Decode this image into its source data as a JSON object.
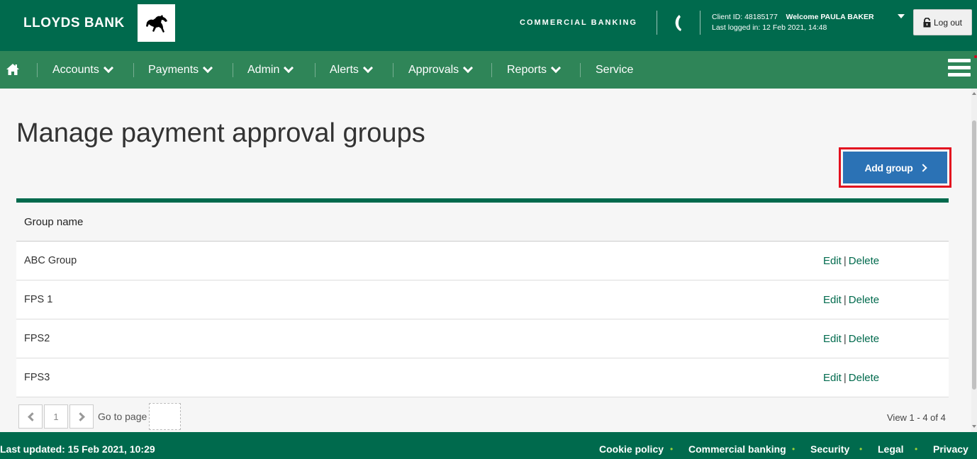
{
  "header": {
    "brand": "LLOYDS BANK",
    "section": "COMMERCIAL BANKING",
    "client_id": "Client ID: 48185177",
    "welcome": "Welcome PAULA BAKER",
    "last_logged": "Last logged in: 12 Feb 2021, 14:48",
    "logout_label": "Log out"
  },
  "nav": {
    "items": [
      {
        "label": "Accounts"
      },
      {
        "label": "Payments"
      },
      {
        "label": "Admin"
      },
      {
        "label": "Alerts"
      },
      {
        "label": "Approvals"
      },
      {
        "label": "Reports"
      },
      {
        "label": "Service"
      }
    ]
  },
  "main": {
    "title": "Manage payment approval groups",
    "add_button_label": "Add group",
    "table": {
      "header": "Group name",
      "rows": [
        {
          "name": "ABC Group",
          "edit": "Edit",
          "sep": "|",
          "delete": "Delete"
        },
        {
          "name": "FPS 1",
          "edit": "Edit",
          "sep": "|",
          "delete": "Delete"
        },
        {
          "name": "FPS2",
          "edit": "Edit",
          "sep": "|",
          "delete": "Delete"
        },
        {
          "name": "FPS3",
          "edit": "Edit",
          "sep": "|",
          "delete": "Delete"
        }
      ]
    },
    "pagination": {
      "current_page": "1",
      "goto_label": "Go to page",
      "view_count": "View 1 - 4 of 4"
    }
  },
  "footer": {
    "last_updated": "Last updated: 15 Feb 2021, 10:29",
    "links": [
      "Cookie policy",
      "Commercial banking",
      "Security",
      "Legal",
      "Privacy"
    ],
    "dot": "•"
  },
  "colors": {
    "brand_green": "#006a4d",
    "nav_green": "#2f8558",
    "primary_blue": "#2b72b5",
    "highlight_red": "#e3101f"
  }
}
